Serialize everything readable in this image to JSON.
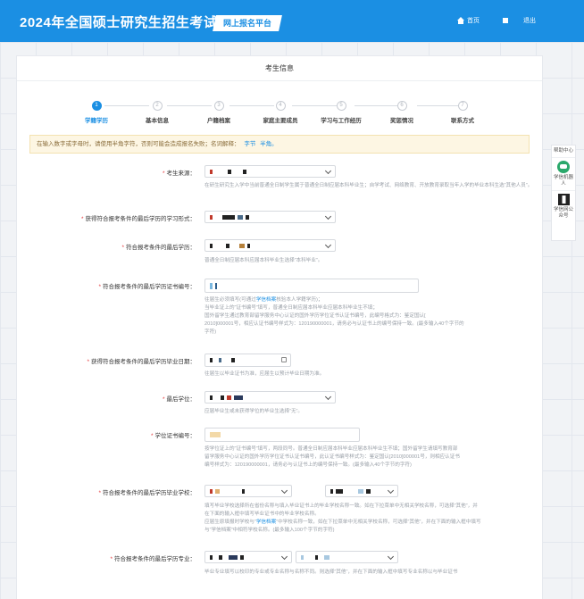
{
  "header": {
    "title": "2024年全国硕士研究生招生考试",
    "badge": "网上报名平台",
    "home_label": "首页",
    "exit_label": "退出",
    "color": "#1b8fe3"
  },
  "card": {
    "title": "考生信息"
  },
  "steps": [
    {
      "num": "1",
      "label": "学籍学历",
      "active": true
    },
    {
      "num": "2",
      "label": "基本信息",
      "active": false
    },
    {
      "num": "3",
      "label": "户籍档案",
      "active": false
    },
    {
      "num": "4",
      "label": "家庭主要成员",
      "active": false
    },
    {
      "num": "5",
      "label": "学习与工作经历",
      "active": false
    },
    {
      "num": "6",
      "label": "奖惩情况",
      "active": false
    },
    {
      "num": "7",
      "label": "联系方式",
      "active": false
    }
  ],
  "notice": {
    "text": "在输入数字或字母时，请使用半角字符，否则可能会造成报名失败；名词解释：",
    "link1": "字节",
    "link2": "半角。"
  },
  "form": {
    "source": {
      "label": "考生来源：",
      "help": "在研生研究生入学中当前普通全日制学生属于普通全日制应届本科毕业生；自学考试、网络教育、开放教育录取当年入学的毕业本科生选“其他人员”。"
    },
    "degree_form": {
      "label": "获得符合报考条件的最后学历的学习形式："
    },
    "last_degree": {
      "label": "符合报考条件的最后学历：",
      "help": "普通全日制应届本科应届本科毕业生选择“本科毕业”。"
    },
    "cert_no": {
      "label": "符合报考条件的最后学历证书编号：",
      "help_pre": "往届生必须填写(可通过",
      "help_link": "学信档案",
      "help_post": "核验本人学籍学历)；",
      "help2": "当毕业证上的“证书编号”填写，普通全日制应届本科毕业应届本科毕业生不填；",
      "help3": "国外留学生通过教育部留学服务中心认证的国外学历学位证书认证书编号，此编号格式为：鉴定国认[",
      "help4": "2010]000001号，相应认证书编号样式为：120190000001，请务必与认证书上的编号保持一致。(最多输入40个字节的",
      "help5": "字符)"
    },
    "grad_date": {
      "label": "获得符合报考条件的最后学历毕业日期：",
      "help": "往届生以毕业证书为准，应届生以预计毕业日期为准。"
    },
    "last_degree_type": {
      "label": "最后学位：",
      "help": "应届毕业生或未获得学位的毕业生选择“无”。"
    },
    "degree_cert_no": {
      "label": "学位证书编号：",
      "help1": "按学位证上的“证书编号”填写，两段同号。普通全日制应届本科毕业应届本科毕业生不填；国外留学生请填写教育部",
      "help2": "留学服务中心认证的国外学历学位证书认证书编号，此认证书编号样式为：鉴定国认[2010]000001号，则相应认证书",
      "help3": "编号样式为：120190000001，请务必与认证书上的编号保持一致。(最多输入40个字节的字符)"
    },
    "school": {
      "label": "符合报考条件的最后学历毕业学校：",
      "help1": "填写毕业学校选择所在省份名称与填入毕业证书上的毕业学校名称一致。如在下拉菜单中无相关学校名称，可选择“其他”，并",
      "help2": "在下面的输入框中填写毕业证书中的毕业学校名称。",
      "help3_pre": "应届生原填报时学校与“",
      "help3_link": "学信档案",
      "help3_post": "”中学校名称一致，如在下拉菜单中无相关学校名称，可选择“其他”，并在下面的输入框中填写",
      "help4": "与“学信档案”中相符学校名称。(最多输入100个字节的字符)"
    },
    "major": {
      "label": "符合报考条件的最后学历专业：",
      "help": "毕业专业填写以校印的专业或专业名称与名称不同。则选择“其他”，并在下面的输入框中填写专业名称以与毕业证书"
    }
  },
  "sidebar": {
    "help": "帮助中心",
    "robot": "学信机器人",
    "wechat": "学信网公众号"
  }
}
